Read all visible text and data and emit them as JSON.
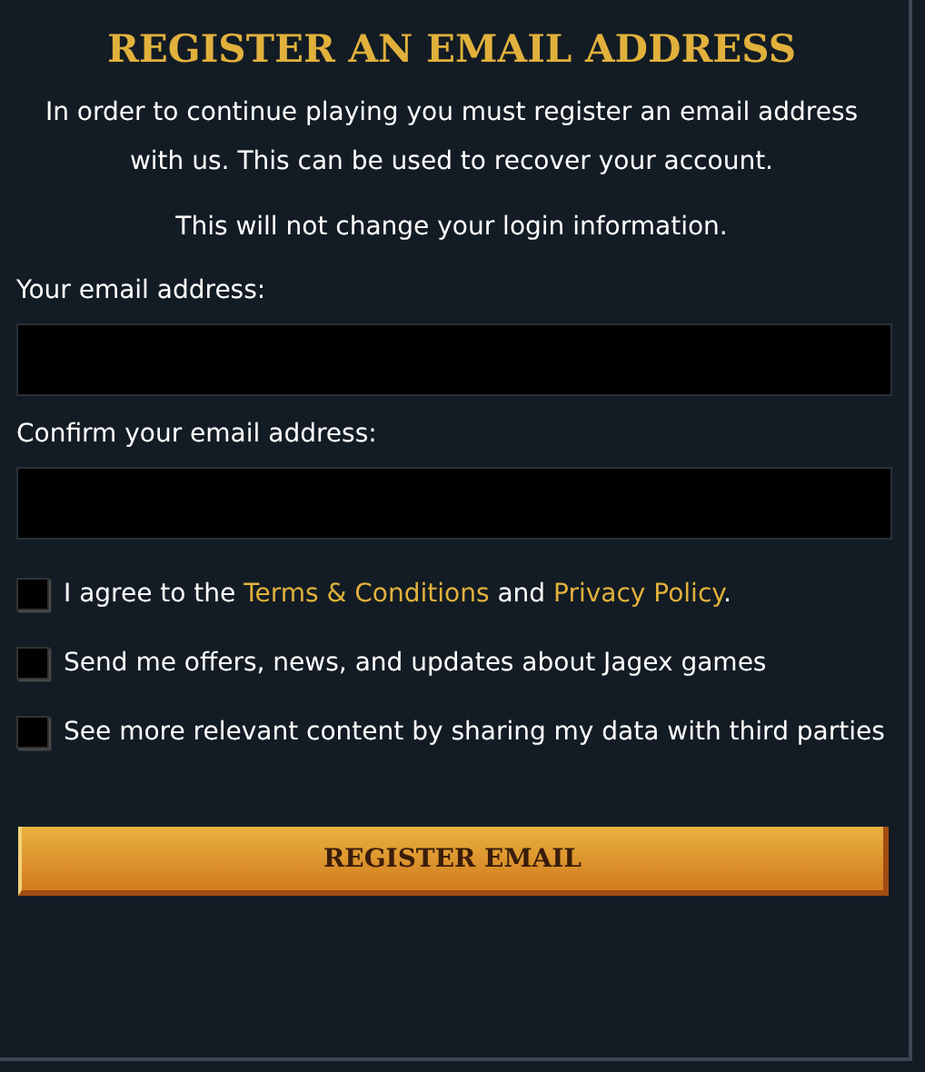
{
  "title": "REGISTER AN EMAIL ADDRESS",
  "paragraphs": [
    "In order to continue playing you must register an email address with us. This can be used to recover your account.",
    "This will not change your login information."
  ],
  "fields": [
    {
      "label": "Your email address:"
    },
    {
      "label": "Confirm your email address:"
    }
  ],
  "consents": [
    {
      "checked": false,
      "parts": [
        {
          "kind": "text",
          "text": "I agree to the "
        },
        {
          "kind": "link",
          "text": "Terms & Conditions"
        },
        {
          "kind": "text",
          "text": " and "
        },
        {
          "kind": "link",
          "text": "Privacy Policy"
        },
        {
          "kind": "text",
          "text": "."
        }
      ]
    },
    {
      "checked": false,
      "parts": [
        {
          "kind": "text",
          "text": "Send me offers, news, and updates about Jagex games"
        }
      ]
    },
    {
      "checked": false,
      "parts": [
        {
          "kind": "text",
          "text": "See more relevant content by sharing my data with third parties"
        }
      ]
    }
  ],
  "button": "REGISTER EMAIL"
}
